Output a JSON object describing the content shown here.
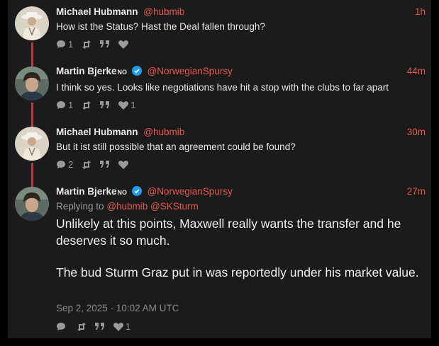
{
  "tweets": [
    {
      "name": "Michael Hubmann",
      "handle": "@hubmib",
      "time": "1h",
      "text": "How ist the Status? Hast the Deal fallen through?",
      "replies": "1",
      "likes": ""
    },
    {
      "name": "Martin Bjerke",
      "flag": "NO",
      "handle": "@NorwegianSpursy",
      "time": "44m",
      "text": "I think so yes. Looks like negotiations have hit a stop with the clubs to far apart",
      "replies": "1",
      "likes": "1"
    },
    {
      "name": "Michael Hubmann",
      "handle": "@hubmib",
      "time": "30m",
      "text": "But it ist still possible that an agreement could be found?",
      "replies": "2",
      "likes": ""
    },
    {
      "name": "Martin Bjerke",
      "flag": "NO",
      "handle": "@NorwegianSpursy",
      "time": "27m",
      "replying_label": "Replying to",
      "replying_mentions": "@hubmib @SKSturm",
      "paragraph1": "Unlikely at this points, Maxwell really wants the transfer and he deserves it so much.",
      "paragraph2": "The bud Sturm Graz put in was reportedly under his market value.",
      "date": "Sep 2, 2025 · 10:02 AM UTC",
      "replies": "",
      "likes": "1"
    }
  ],
  "colors": {
    "accent": "#e8554e",
    "thread_line": "#c0393b",
    "verified": "#1d9bf0",
    "background": "#1b1b1b"
  },
  "icons": [
    "comment-icon",
    "retweet-icon",
    "quote-icon",
    "heart-icon",
    "verified-badge-icon"
  ]
}
